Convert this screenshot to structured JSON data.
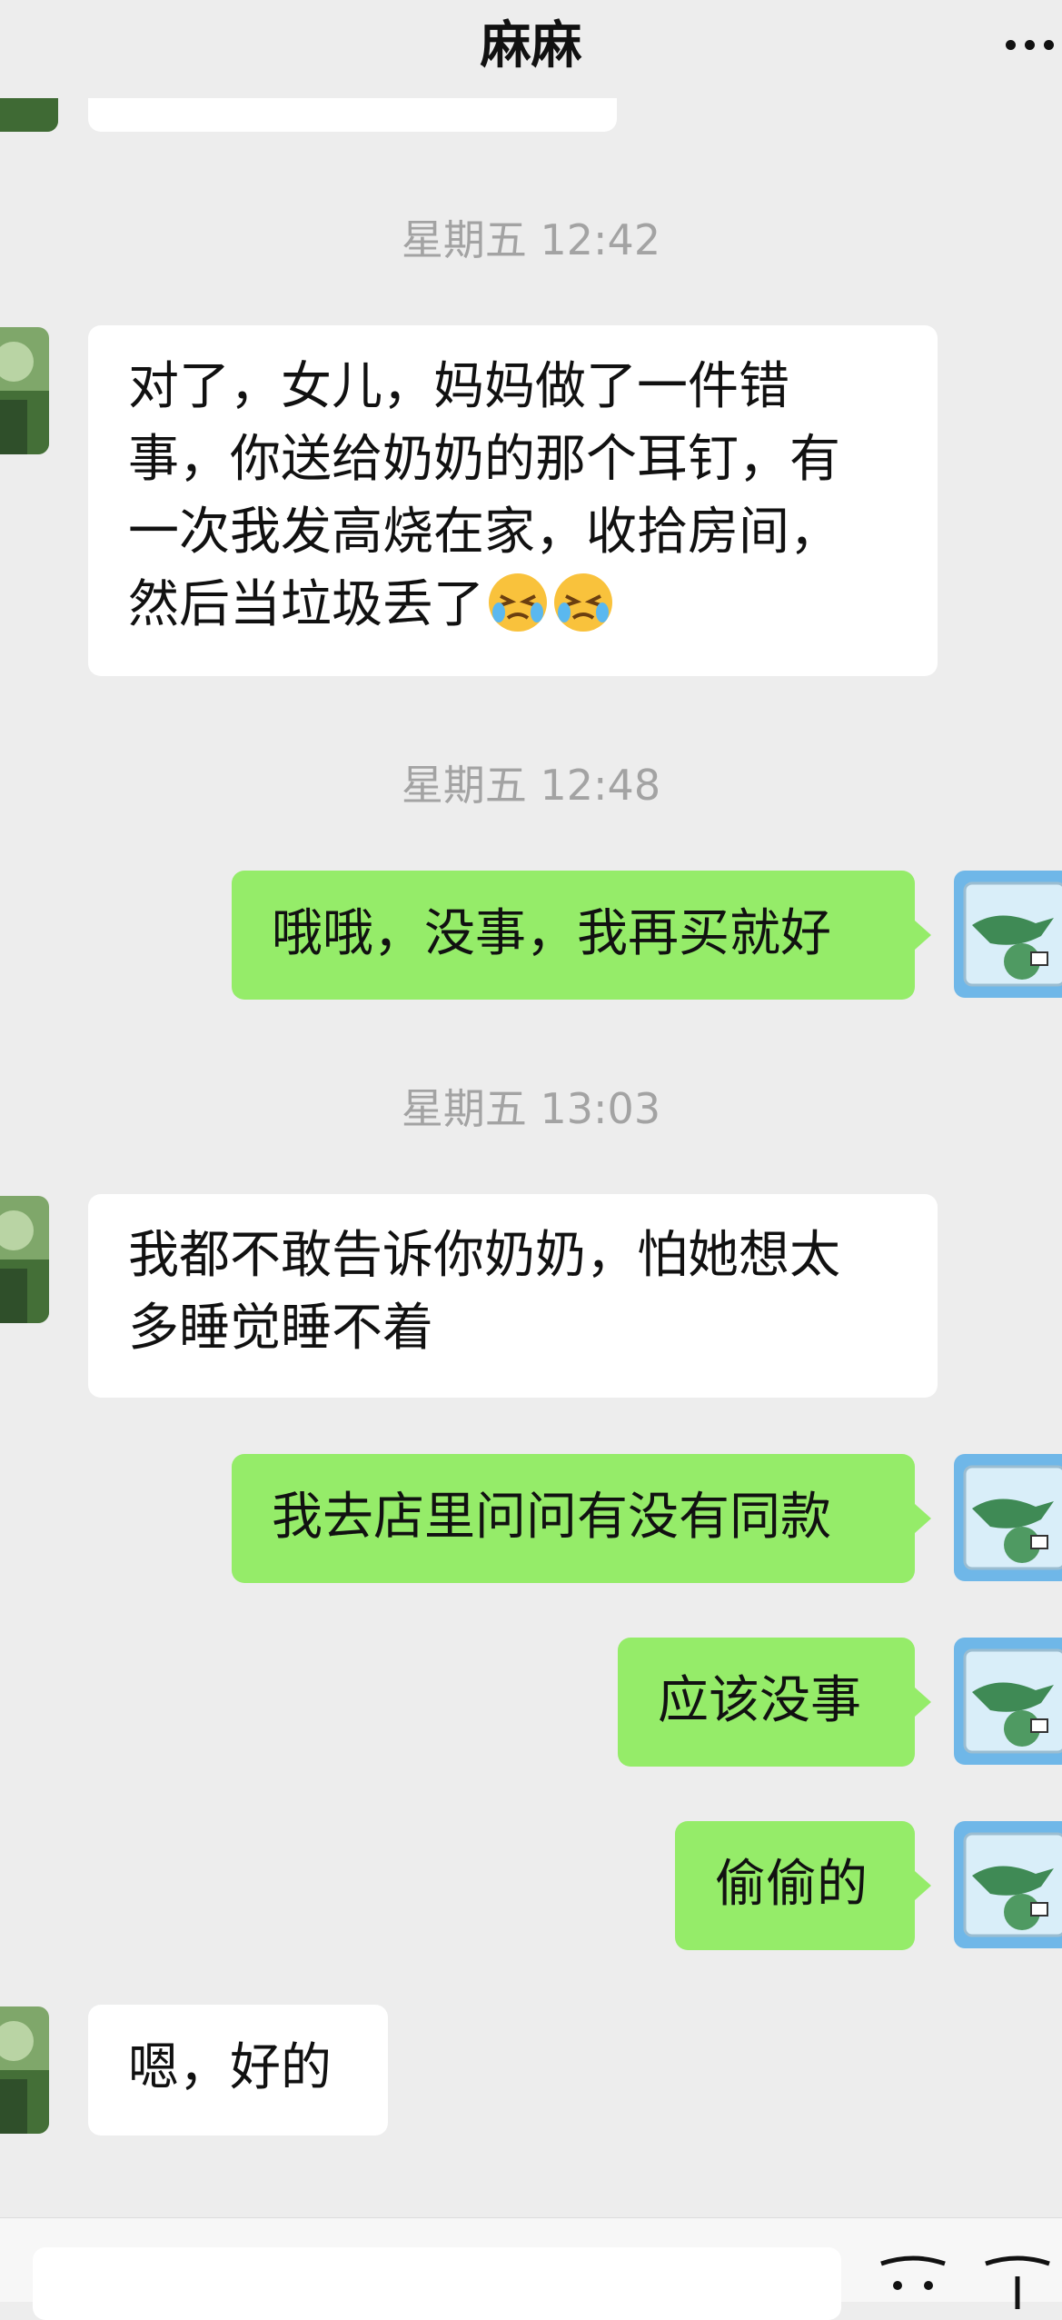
{
  "header": {
    "title": "麻麻"
  },
  "messages": {
    "top_partial": "",
    "ts1": "星期五 12:42",
    "msg1": "对了，女儿，妈妈做了一件错\n事，你送给奶奶的那个耳钉，有\n一次我发高烧在家，收拾房间，\n然后当垃圾丢了",
    "ts2": "星期五 12:48",
    "msg2": "哦哦，没事，我再买就好",
    "ts3": "星期五 13:03",
    "msg3": "我都不敢告诉你奶奶，怕她想太\n多睡觉睡不着",
    "msg4": "我去店里问问有没有同款",
    "msg5": "应该没事",
    "msg6": "偷偷的",
    "msg7": "嗯，好的"
  },
  "icons": {
    "more": "more-dots-icon",
    "emoji": "crying-face-emoji",
    "voice": "voice-icon",
    "sticker": "emoji-icon"
  }
}
